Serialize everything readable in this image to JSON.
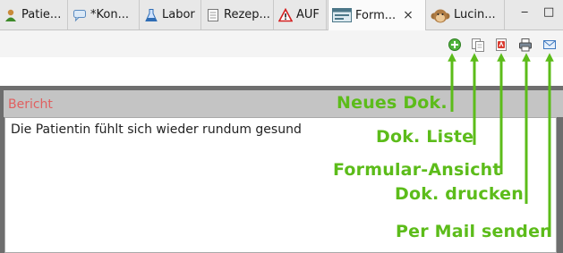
{
  "tabs": [
    {
      "label": "Patie...",
      "icon": "person-icon"
    },
    {
      "label": "*Kon...",
      "icon": "speech-bubble-icon"
    },
    {
      "label": "Labor",
      "icon": "flask-icon"
    },
    {
      "label": "Rezep...",
      "icon": "document-icon"
    },
    {
      "label": "AUF",
      "icon": "warning-icon"
    },
    {
      "label": "Form...",
      "icon": "form-view-icon",
      "active": true
    },
    {
      "label": "Lucin...",
      "icon": "monkey-icon"
    }
  ],
  "window_controls": {
    "minimize": "‒",
    "maximize": "□"
  },
  "toolbar": {
    "buttons": [
      {
        "name": "new-document",
        "icon": "plus-circle-icon"
      },
      {
        "name": "document-list",
        "icon": "copy-icon"
      },
      {
        "name": "form-view",
        "icon": "pdf-icon"
      },
      {
        "name": "print-document",
        "icon": "printer-icon"
      },
      {
        "name": "send-mail",
        "icon": "envelope-icon"
      }
    ]
  },
  "section": {
    "title": "Bericht",
    "content": "Die Patientin fühlt sich wieder rundum gesund"
  },
  "annotations": {
    "new_doc": "Neues Dok.",
    "doc_list": "Dok. Liste",
    "form_view": "Formular-Ansicht",
    "doc_print": "Dok. drucken",
    "send_mail": "Per Mail senden"
  },
  "colors": {
    "annotation": "#5cbc1a",
    "section_title": "#e06060"
  }
}
